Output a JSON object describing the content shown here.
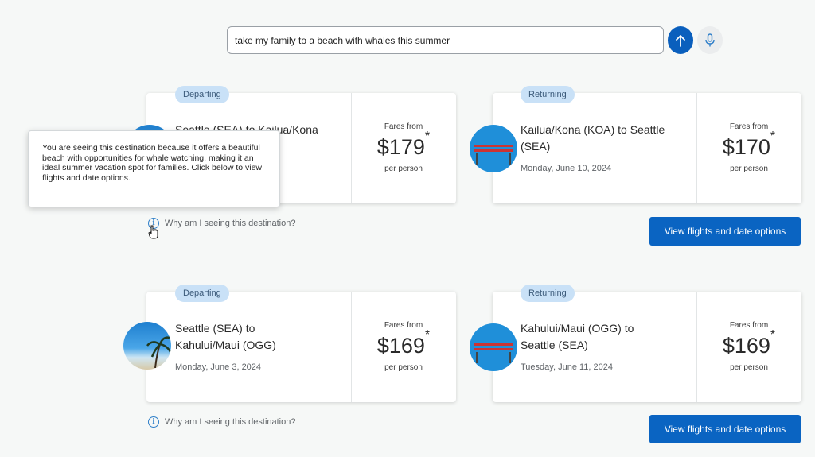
{
  "search": {
    "query": "take my family to a beach with whales this summer"
  },
  "icons": {
    "send": "arrow-up-icon",
    "mic": "microphone-icon",
    "info": "info-icon"
  },
  "colors": {
    "primary": "#0a64c2",
    "pill_bg": "#c9e1f7",
    "info": "#2f7fc9"
  },
  "tooltip": {
    "text": "You are seeing this destination because it offers a beautiful beach with opportunities for whale watching, making it an ideal summer vacation spot for families. Click below to view flights and date options."
  },
  "trips": [
    {
      "departing": {
        "label": "Departing",
        "route_line1": "Seattle (SEA) to Kailua/Kona",
        "fare_label": "Fares from",
        "price": "$179",
        "asterisk": "*",
        "per": "per person"
      },
      "returning": {
        "label": "Returning",
        "route_line1": "Kailua/Kona (KOA) to Seattle",
        "route_line2": "(SEA)",
        "date": "Monday, June 10, 2024",
        "fare_label": "Fares from",
        "price": "$170",
        "asterisk": "*",
        "per": "per person"
      },
      "why": "Why am I seeing this destination?",
      "view_button": "View flights and date options"
    },
    {
      "departing": {
        "label": "Departing",
        "route_line1": "Seattle (SEA) to",
        "route_line2": "Kahului/Maui (OGG)",
        "date": "Monday, June 3, 2024",
        "fare_label": "Fares from",
        "price": "$169",
        "asterisk": "*",
        "per": "per person"
      },
      "returning": {
        "label": "Returning",
        "route_line1": "Kahului/Maui (OGG) to",
        "route_line2": "Seattle (SEA)",
        "date": "Tuesday, June 11, 2024",
        "fare_label": "Fares from",
        "price": "$169",
        "asterisk": "*",
        "per": "per person"
      },
      "why": "Why am I seeing this destination?",
      "view_button": "View flights and date options"
    }
  ]
}
